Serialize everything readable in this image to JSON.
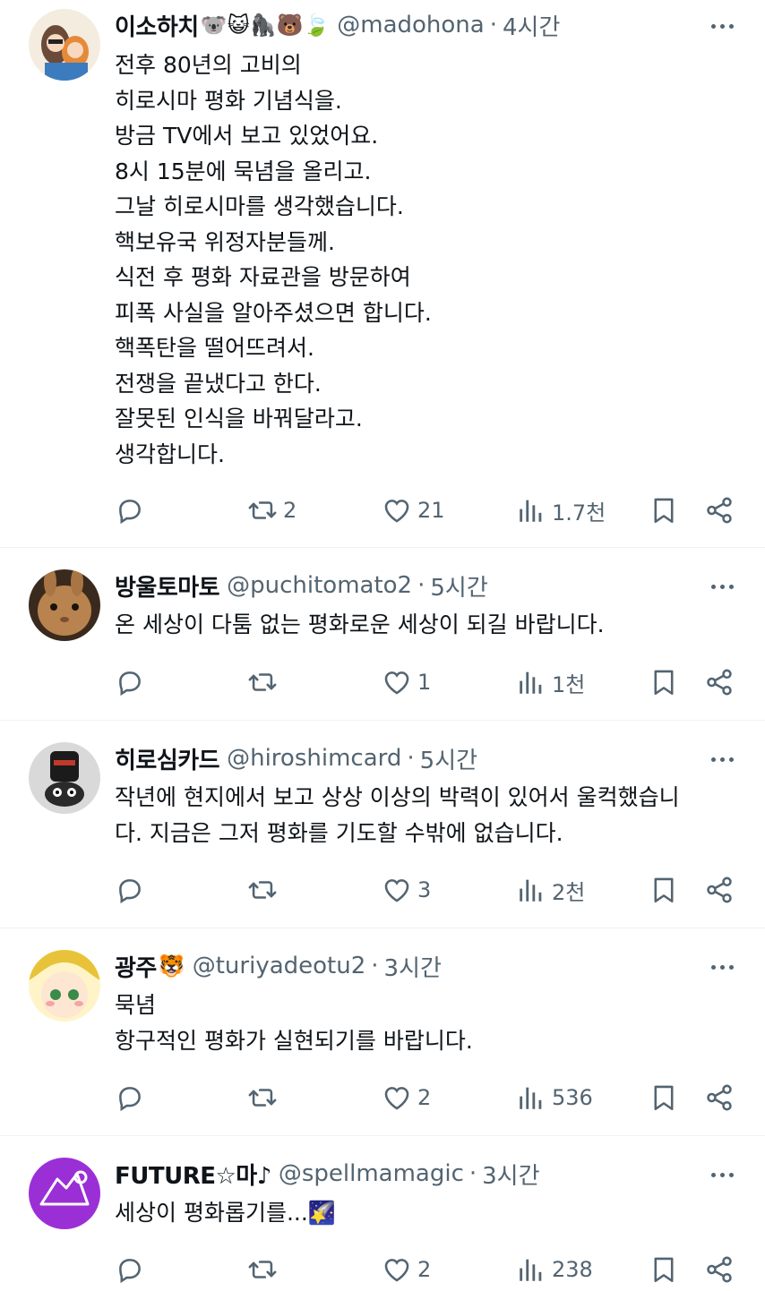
{
  "posts": [
    {
      "name": "이소하치",
      "name_emoji": "🐨😺🦍🐻🍃",
      "handle": "@madohona",
      "time": "4시간",
      "lines": [
        "전후 80년의 고비의",
        "히로시마 평화 기념식을.",
        "방금 TV에서 보고 있었어요.",
        "8시 15분에 묵념을 올리고.",
        "그날 히로시마를 생각했습니다.",
        "핵보유국 위정자분들께.",
        "식전 후 평화 자료관을 방문하여",
        "피폭 사실을 알아주셨으면 합니다.",
        "핵폭탄을 떨어뜨려서.",
        "전쟁을 끝냈다고 한다.",
        "잘못된 인식을 바꿔달라고.",
        "생각합니다."
      ],
      "retweets": "2",
      "likes": "21",
      "views": "1.7천"
    },
    {
      "name": "방울토마토",
      "name_emoji": "",
      "handle": "@puchitomato2",
      "time": "5시간",
      "lines": [
        "온 세상이 다툼 없는 평화로운 세상이 되길 바랍니다."
      ],
      "retweets": "",
      "likes": "1",
      "views": "1천"
    },
    {
      "name": "히로심카드",
      "name_emoji": "",
      "handle": "@hiroshimcard",
      "time": "5시간",
      "lines": [
        "작년에 현지에서 보고 상상 이상의 박력이 있어서 울컥했습니",
        "다. 지금은 그저 평화를 기도할 수밖에 없습니다."
      ],
      "retweets": "",
      "likes": "3",
      "views": "2천"
    },
    {
      "name": "광주",
      "name_emoji": "🐯",
      "handle": "@turiyadeotu2",
      "time": "3시간",
      "lines": [
        "묵념",
        "항구적인 평화가 실현되기를 바랍니다."
      ],
      "retweets": "",
      "likes": "2",
      "views": "536"
    },
    {
      "name": "FUTURE☆마♪",
      "name_emoji": "",
      "handle": "@spellmamagic",
      "time": "3시간",
      "lines": [
        "세상이 평화롭기를...🌠"
      ],
      "retweets": "",
      "likes": "2",
      "views": "238"
    }
  ],
  "separator": "·",
  "colors": {
    "text": "#0f1419",
    "secondary": "#536471",
    "divider": "#eff3f4"
  }
}
